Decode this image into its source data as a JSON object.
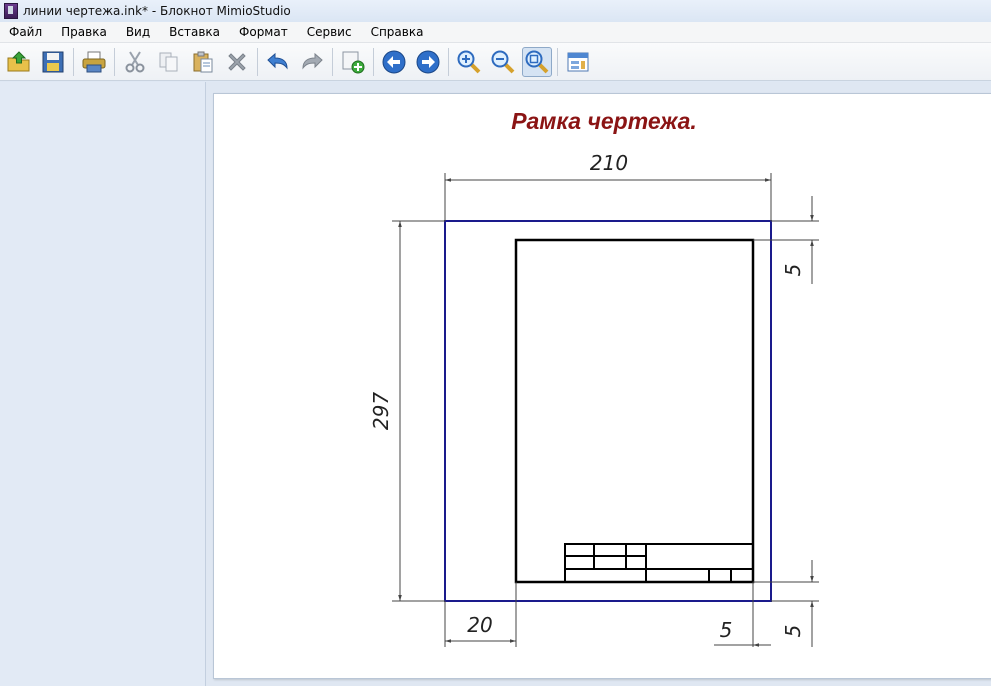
{
  "window": {
    "title": "линии чертежа.ink* - Блокнот MimioStudio"
  },
  "menu": [
    "Файл",
    "Правка",
    "Вид",
    "Вставка",
    "Формат",
    "Сервис",
    "Справка"
  ],
  "toolbar": {
    "icons": [
      "open-icon",
      "save-icon",
      "print-icon",
      "cut-icon",
      "copy-icon",
      "paste-icon",
      "delete-icon",
      "undo-icon",
      "redo-icon",
      "add-page-icon",
      "previous-page-icon",
      "next-page-icon",
      "zoom-in-icon",
      "zoom-out-icon",
      "zoom-fit-icon",
      "gallery-icon"
    ],
    "active_icon": "zoom-fit-icon"
  },
  "drawing": {
    "title": "Рамка чертежа.",
    "title_color": "#8b1414",
    "sheet_border_color": "#1a1a8c",
    "dimensions": {
      "width": "210",
      "height": "297",
      "left_margin": "20",
      "top_margin": "5",
      "right_margin": "5",
      "bottom_margin": "5"
    }
  }
}
